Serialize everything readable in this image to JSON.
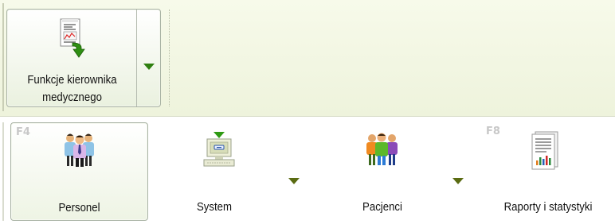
{
  "ribbon": {
    "main_button": {
      "label_line1": "Funkcje kierownika",
      "label_line2": "medycznego",
      "icon": "report-arrow-icon",
      "dropdown_icon": "chevron-down-icon"
    }
  },
  "tabs": [
    {
      "key": "F4",
      "label": "Personel",
      "icon": "staff-people-icon",
      "selected": true
    },
    {
      "key": "",
      "label": "System",
      "icon": "computer-icon",
      "has_dropdown": true
    },
    {
      "key": "",
      "label": "Pacjenci",
      "icon": "patients-icon",
      "has_dropdown": true
    },
    {
      "key": "F8",
      "label": "Raporty i statystyki",
      "icon": "report-chart-icon"
    }
  ],
  "colors": {
    "ribbon_bg": "#eef3dc",
    "accent_green": "#2f7f10",
    "dropdown_olive": "#5a6b12",
    "border": "#a9b3a4"
  }
}
